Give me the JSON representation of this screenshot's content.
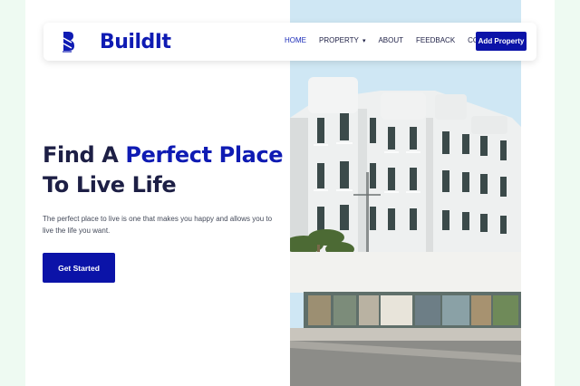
{
  "brand": {
    "name": "BuildIt"
  },
  "nav": {
    "links": [
      {
        "label": "HOME"
      },
      {
        "label": "PROPERTY"
      },
      {
        "label": "ABOUT"
      },
      {
        "label": "FEEDBACK"
      },
      {
        "label": "CONTACT"
      }
    ],
    "cta_label": "Add Property"
  },
  "hero": {
    "title_part1": "Find A ",
    "title_highlight": "Perfect Place",
    "title_part2": " To Live Life",
    "description": "The perfect place to live is one that makes you happy and allows you to live the life you want.",
    "cta_label": "Get Started",
    "image_alt": "white apartment building"
  },
  "colors": {
    "accent": "#0b13a8",
    "heading": "#1d1f45",
    "page_background": "#eefaf2"
  },
  "icons": {
    "logo": "buildit-logo-icon",
    "dropdown": "chevron-down-icon"
  }
}
